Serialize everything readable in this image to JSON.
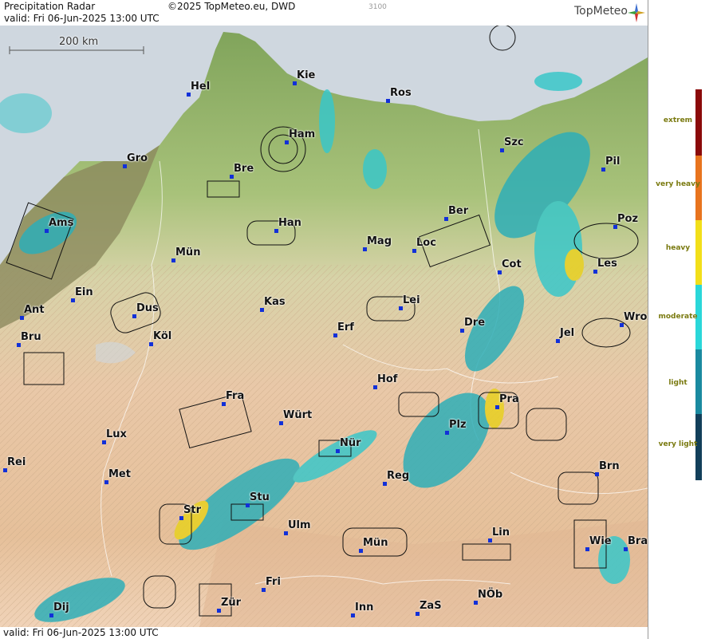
{
  "header": {
    "title": "Precipitation Radar",
    "copyright": "©2025 TopMeteo.eu, DWD",
    "code": "3100",
    "valid": "valid:  Fri   06-Jun-2025 13:00 UTC",
    "logo": "TopMeteo"
  },
  "footer": {
    "valid": "valid:  Fri   06-Jun-2025 13:00 UTC"
  },
  "scale": {
    "label": "200 km"
  },
  "legend": {
    "labels": [
      "extrem",
      "very heavy",
      "heavy",
      "moderate",
      "light",
      "very light"
    ],
    "colors": [
      "#8b0a0a",
      "#e8741e",
      "#f2df1a",
      "#2ad7d9",
      "#1a8aa0",
      "#123f5a"
    ]
  },
  "cities": [
    {
      "name": "Kie"
    },
    {
      "name": "Hel"
    },
    {
      "name": "Ros"
    },
    {
      "name": "Ham"
    },
    {
      "name": "Szc"
    },
    {
      "name": "Gro"
    },
    {
      "name": "Bre"
    },
    {
      "name": "Pil"
    },
    {
      "name": "Ber"
    },
    {
      "name": "Ams"
    },
    {
      "name": "Han"
    },
    {
      "name": "Poz"
    },
    {
      "name": "Mün"
    },
    {
      "name": "Mag"
    },
    {
      "name": "Loc"
    },
    {
      "name": "Cot"
    },
    {
      "name": "Les"
    },
    {
      "name": "Ein"
    },
    {
      "name": "Kas"
    },
    {
      "name": "Lei"
    },
    {
      "name": "Ant"
    },
    {
      "name": "Dus"
    },
    {
      "name": "Dre"
    },
    {
      "name": "Wro"
    },
    {
      "name": "Bru"
    },
    {
      "name": "Köl"
    },
    {
      "name": "Erf"
    },
    {
      "name": "Jel"
    },
    {
      "name": "Hof"
    },
    {
      "name": "Fra"
    },
    {
      "name": "Pra"
    },
    {
      "name": "Würt"
    },
    {
      "name": "Plz"
    },
    {
      "name": "Lux"
    },
    {
      "name": "Nür"
    },
    {
      "name": "Rei"
    },
    {
      "name": "Met"
    },
    {
      "name": "Brn"
    },
    {
      "name": "Reg"
    },
    {
      "name": "Stu"
    },
    {
      "name": "Str"
    },
    {
      "name": "Ulm"
    },
    {
      "name": "Lin"
    },
    {
      "name": "Mün"
    },
    {
      "name": "Wie"
    },
    {
      "name": "Bra"
    },
    {
      "name": "Fri"
    },
    {
      "name": "NÖb"
    },
    {
      "name": "Dij"
    },
    {
      "name": "Zür"
    },
    {
      "name": "Inn"
    },
    {
      "name": "ZaS"
    }
  ]
}
